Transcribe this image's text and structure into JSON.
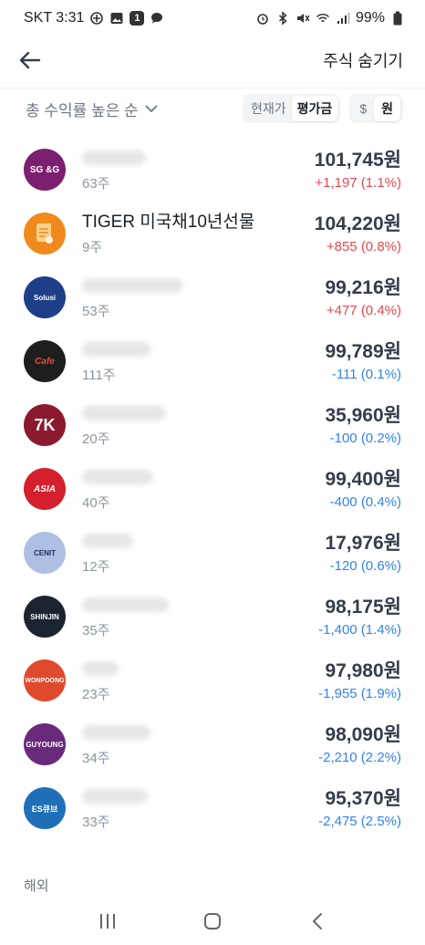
{
  "status_bar": {
    "carrier_time": "SKT 3:31",
    "notification_badge": "1",
    "battery": "99%"
  },
  "header": {
    "hide_stocks_label": "주식 숨기기"
  },
  "controls": {
    "sort_label": "총 수익률 높은 순",
    "price_modes": [
      "현재가",
      "평가금"
    ],
    "active_price_mode": "평가금",
    "currency_modes": [
      "$",
      "원"
    ],
    "active_currency": "원"
  },
  "holdings": [
    {
      "logo": "SG &G",
      "logo_color": "#7b1f6e",
      "name": "",
      "name_hidden": true,
      "shares": "63주",
      "amount": "101,745원",
      "change": "+1,197 (1.1%)",
      "direction": "up"
    },
    {
      "logo": "",
      "logo_color": "#f08a1c",
      "name": "TIGER 미국채10년선물",
      "name_hidden": false,
      "shares": "9주",
      "amount": "104,220원",
      "change": "+855 (0.8%)",
      "direction": "up"
    },
    {
      "logo": "Solusi",
      "logo_color": "#1d3f87",
      "name": "",
      "name_hidden": true,
      "shares": "53주",
      "amount": "99,216원",
      "change": "+477 (0.4%)",
      "direction": "up"
    },
    {
      "logo": "Cafe",
      "logo_color": "#1e1e1e",
      "name": "",
      "name_hidden": true,
      "shares": "111주",
      "amount": "99,789원",
      "change": "-111 (0.1%)",
      "direction": "down"
    },
    {
      "logo": "7K",
      "logo_color": "#8c1a2e",
      "name": "",
      "name_hidden": true,
      "shares": "20주",
      "amount": "35,960원",
      "change": "-100 (0.2%)",
      "direction": "down"
    },
    {
      "logo": "ASIA",
      "logo_color": "#d3202c",
      "name": "",
      "name_hidden": true,
      "shares": "40주",
      "amount": "99,400원",
      "change": "-400 (0.4%)",
      "direction": "down"
    },
    {
      "logo": "CENIT",
      "logo_color": "#aebfe4",
      "name": "",
      "name_hidden": true,
      "shares": "12주",
      "amount": "17,976원",
      "change": "-120 (0.6%)",
      "direction": "down"
    },
    {
      "logo": "SHINJIN",
      "logo_color": "#1c2431",
      "name": "",
      "name_hidden": true,
      "shares": "35주",
      "amount": "98,175원",
      "change": "-1,400 (1.4%)",
      "direction": "down"
    },
    {
      "logo": "WONPOONG",
      "logo_color": "#e04a2c",
      "name": "",
      "name_hidden": true,
      "shares": "23주",
      "amount": "97,980원",
      "change": "-1,955 (1.9%)",
      "direction": "down"
    },
    {
      "logo": "GUYOUNG",
      "logo_color": "#6a2a7c",
      "name": "",
      "name_hidden": true,
      "shares": "34주",
      "amount": "98,090원",
      "change": "-2,210 (2.2%)",
      "direction": "down"
    },
    {
      "logo": "ES큐브",
      "logo_color": "#1f6fb8",
      "name": "",
      "name_hidden": true,
      "shares": "33주",
      "amount": "95,370원",
      "change": "-2,475 (2.5%)",
      "direction": "down"
    }
  ],
  "sections": {
    "overseas_label": "해외"
  },
  "colors": {
    "up": "#e5484d",
    "down": "#3182f6"
  }
}
